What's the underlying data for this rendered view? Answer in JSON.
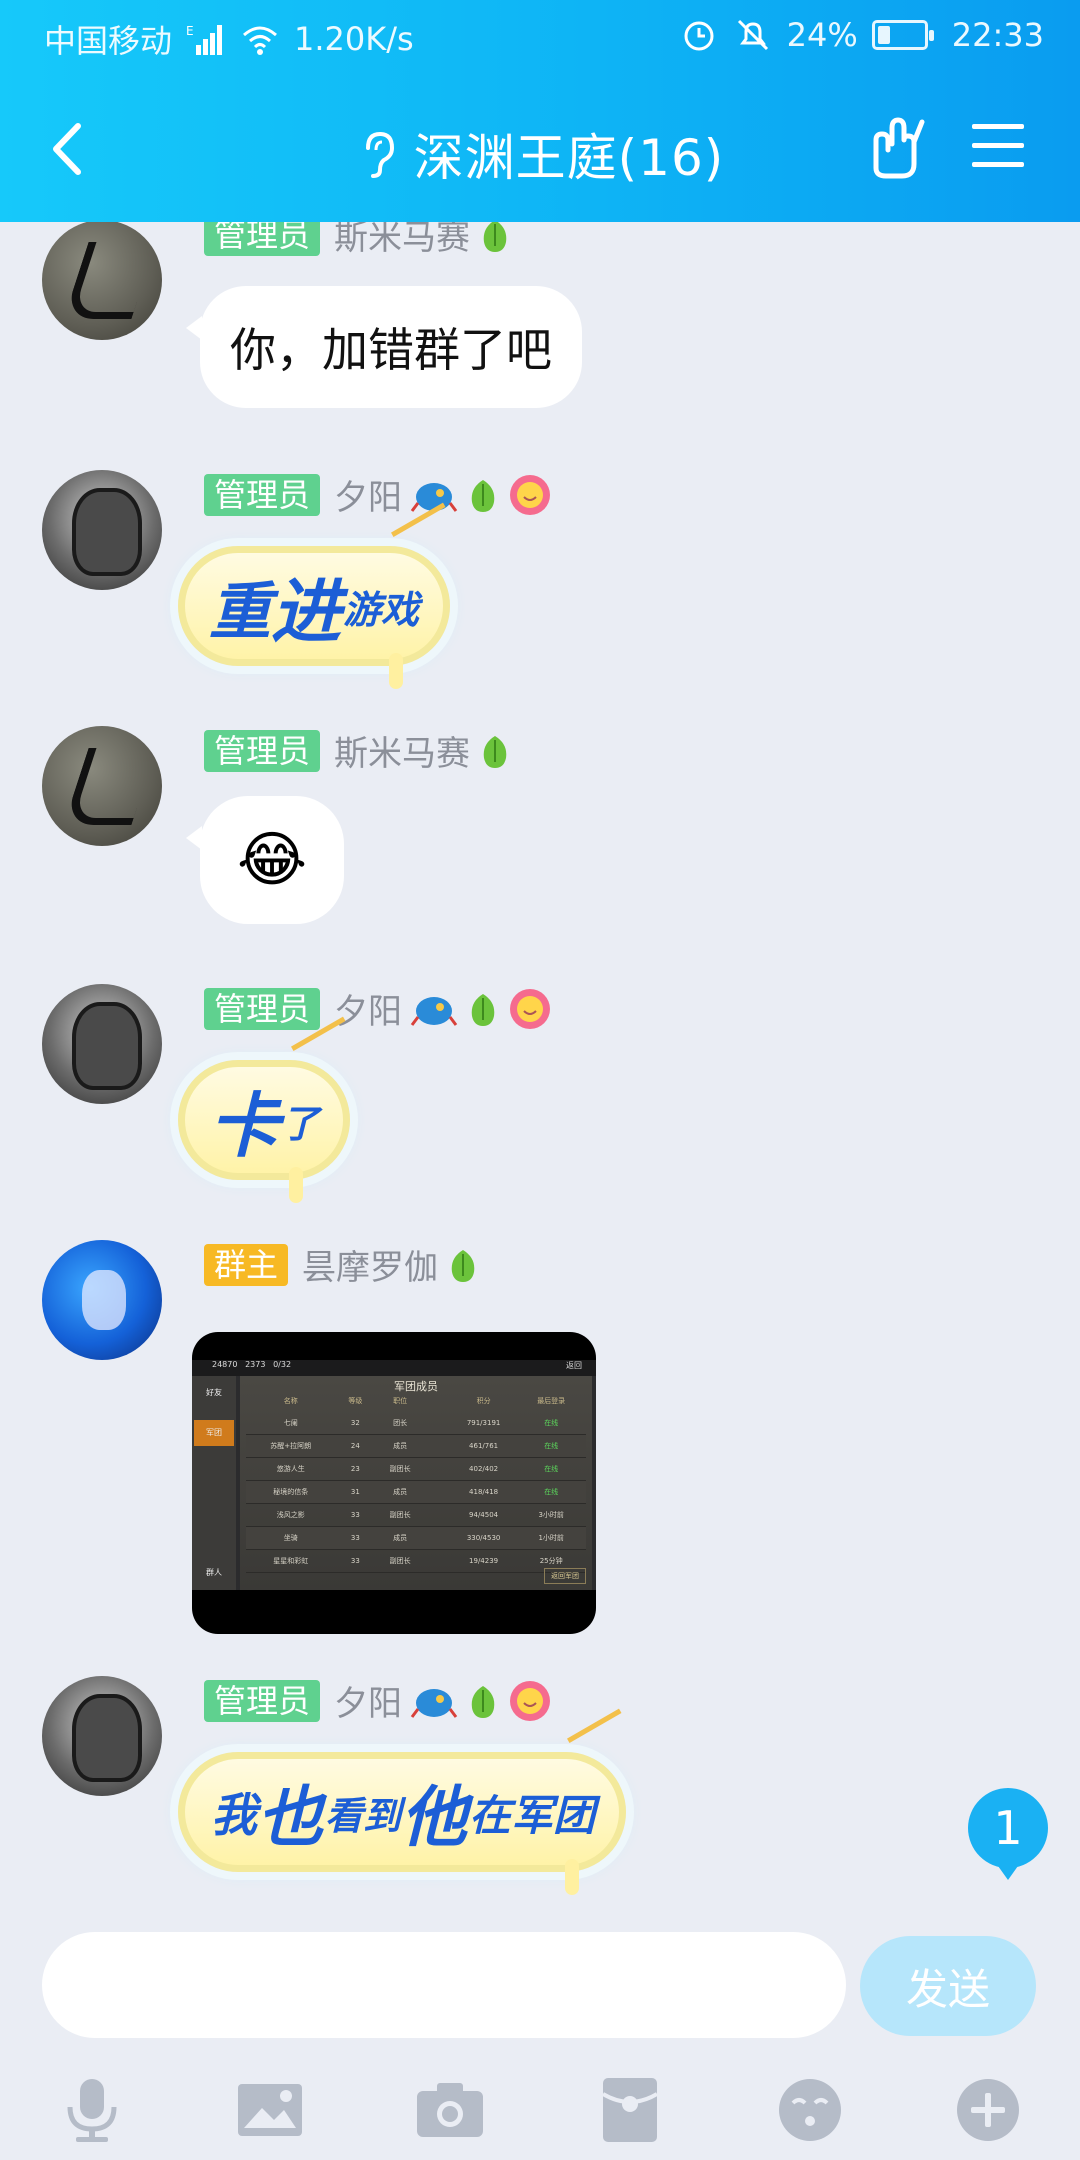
{
  "status_bar": {
    "carrier": "中国移动",
    "net_speed": "1.20K/s",
    "battery": "24%",
    "time": "22:33"
  },
  "nav": {
    "title": "深渊王庭(16)",
    "icons": [
      "back-icon",
      "ear-icon",
      "gesture-icon",
      "menu-icon"
    ]
  },
  "messages": [
    {
      "role": "管理员",
      "sender": "斯米马赛",
      "type": "text",
      "text": "你，加错群了吧"
    },
    {
      "role": "管理员",
      "sender": "夕阳",
      "type": "sticker",
      "parts": [
        "重",
        "进",
        "游戏"
      ]
    },
    {
      "role": "管理员",
      "sender": "斯米马赛",
      "type": "emoji",
      "text": "😂"
    },
    {
      "role": "管理员",
      "sender": "夕阳",
      "type": "sticker",
      "parts": [
        "卡",
        "了"
      ]
    },
    {
      "role": "群主",
      "sender": "昙摩罗伽",
      "type": "image",
      "image": {
        "title": "军团成员",
        "top_values": [
          "24870",
          "2373",
          "0/32"
        ],
        "back_label": "返回",
        "side_tabs": [
          "好友",
          "军团",
          "群人"
        ],
        "headers": [
          "名称",
          "等级",
          "职位",
          "",
          "积分",
          "最后登录"
        ],
        "rows": [
          [
            "七阑",
            "32",
            "团长",
            "",
            "791/3191",
            "在线"
          ],
          [
            "苏醒+拉阿朗",
            "24",
            "成员",
            "",
            "461/761",
            "在线"
          ],
          [
            "悠游人生",
            "23",
            "副团长",
            "",
            "402/402",
            "在线"
          ],
          [
            "秘境的信条",
            "31",
            "成员",
            "",
            "418/418",
            "在线"
          ],
          [
            "浅风之影",
            "33",
            "副团长",
            "",
            "94/4504",
            "3小时前"
          ],
          [
            "坐骑",
            "33",
            "成员",
            "",
            "330/4530",
            "1小时前"
          ],
          [
            "星星和彩虹",
            "33",
            "副团长",
            "",
            "19/4239",
            "25分钟"
          ]
        ],
        "return_button": "返回军团"
      }
    },
    {
      "role": "管理员",
      "sender": "夕阳",
      "type": "sticker",
      "parts": [
        "我",
        "也",
        "看到",
        "他",
        "在军团"
      ]
    }
  ],
  "unread_count": "1",
  "input": {
    "value": "",
    "placeholder": "",
    "send_label": "发送"
  },
  "toolbar": [
    "mic-icon",
    "image-icon",
    "camera-icon",
    "red-packet-icon",
    "emoji-face-icon",
    "plus-icon"
  ],
  "colors": {
    "header": "#0eb4f5",
    "admin_badge": "#5fd18f",
    "owner_badge": "#f7b924",
    "send_disabled": "#b6e6fb",
    "sticker_text": "#1c5ed6"
  }
}
